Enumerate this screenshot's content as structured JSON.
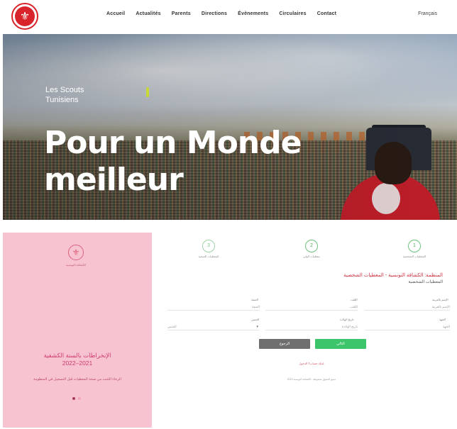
{
  "navbar": {
    "logo_glyph": "⚜",
    "links": [
      {
        "label": "Accueil"
      },
      {
        "label": "Actualités"
      },
      {
        "label": "Parents"
      },
      {
        "label": "Directions"
      },
      {
        "label": "Évènements"
      },
      {
        "label": "Circulaires"
      },
      {
        "label": "Contact"
      }
    ],
    "language": "Français"
  },
  "hero": {
    "subtitle": "Les Scouts Tunisiens",
    "title": "Pour un Monde meilleur"
  },
  "registration_panel": {
    "emblem_glyph": "⚜",
    "emblem_label": "الكشافة التونسية",
    "title_line1": "الإنخراطات بالسنة الكشفية",
    "title_line2": "2022–2021",
    "description": "الرجاء التثبت من صحة المعطيات قبل التسجيل في المنظومة",
    "dots_active": 1
  },
  "form": {
    "steps": [
      {
        "number": "3",
        "label": "المعطيات الصحية"
      },
      {
        "number": "2",
        "label": "معطيات الولي"
      },
      {
        "number": "1",
        "label": "المعطيات الشخصية"
      }
    ],
    "heading": "المنظمة: الكشافة التونسية - المعطيات الشخصية",
    "subheading": "المعطيات الشخصية",
    "fields": [
      {
        "label": "الإسم بالعربية",
        "value": "الإسم بالعربية"
      },
      {
        "label": "اللقب",
        "value": "اللقب"
      },
      {
        "label": "الصفة",
        "value": "الصفة"
      },
      {
        "label": "الجهة",
        "value": "الجهة"
      },
      {
        "label": "تاريخ الولادة",
        "value": "تاريخ الولادة"
      },
      {
        "label": "الجنس",
        "value": "الجنس"
      }
    ],
    "back_label": "الرجوع",
    "next_label": "التالي",
    "login_link": "لديك حساب؟ الدخول",
    "footer_note": "جميع الحقوق محفوظة - الكشافة التونسية 2022"
  }
}
